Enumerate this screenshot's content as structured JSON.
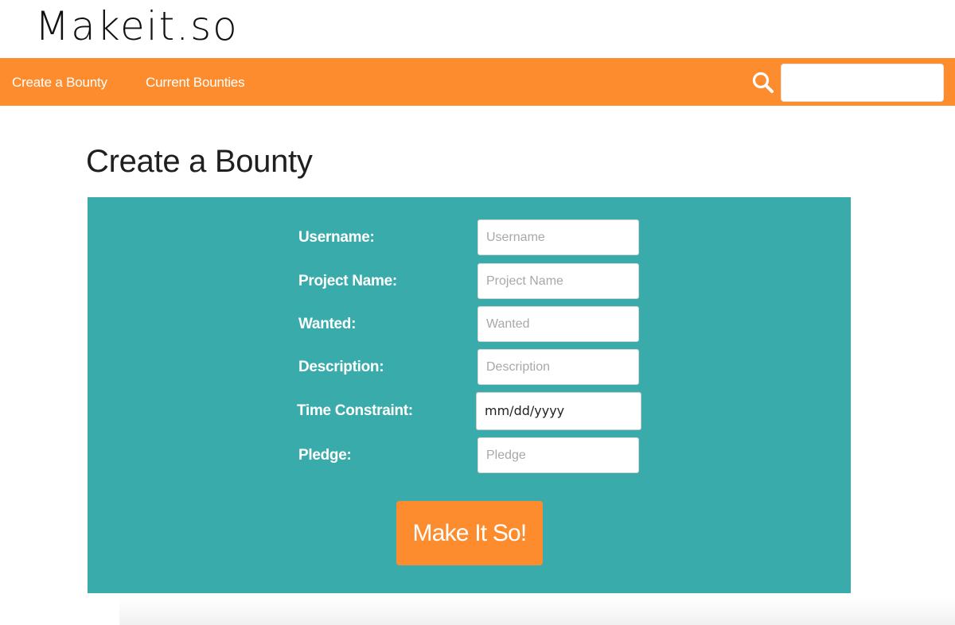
{
  "brand": {
    "logo_text": "Makeit.so"
  },
  "nav": {
    "links": [
      {
        "label": "Create a Bounty"
      },
      {
        "label": "Current Bounties"
      }
    ],
    "search": {
      "value": "",
      "placeholder": ""
    }
  },
  "page": {
    "title": "Create a Bounty"
  },
  "form": {
    "fields": [
      {
        "label": "Username:",
        "placeholder": "Username"
      },
      {
        "label": "Project Name:",
        "placeholder": "Project Name"
      },
      {
        "label": "Wanted:",
        "placeholder": "Wanted"
      },
      {
        "label": "Description:",
        "placeholder": "Description"
      },
      {
        "label": "Time Constraint:",
        "value": "mm/dd/yyyy"
      },
      {
        "label": "Pledge:",
        "placeholder": "Pledge"
      }
    ],
    "submit_label": "Make It So!"
  },
  "colors": {
    "accent_orange": "#fd8c2e",
    "panel_teal": "#39abab"
  }
}
